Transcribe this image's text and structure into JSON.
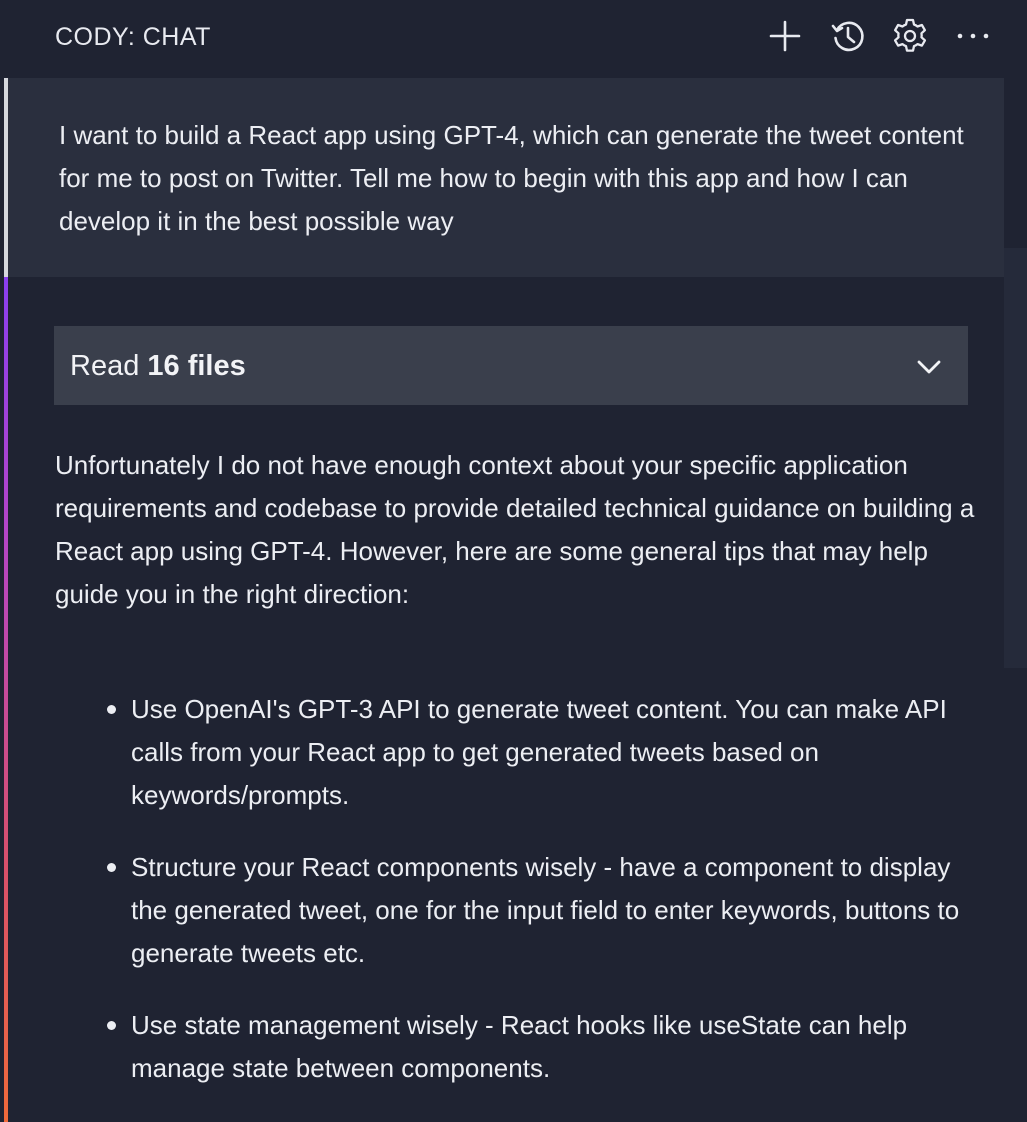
{
  "header": {
    "title": "CODY: CHAT",
    "icons": {
      "new": "plus-icon",
      "history": "history-icon",
      "settings": "gear-icon",
      "more": "ellipsis-icon"
    }
  },
  "human_message": {
    "text": "I want to build a React app using GPT-4, which can generate the tweet content for me to post on Twitter. Tell me how to begin with this app and how I can develop it in the best possible way"
  },
  "assistant_message": {
    "context": {
      "prefix": "Read ",
      "count_label": "16 files",
      "chevron": "chevron-down-icon"
    },
    "intro": "Unfortunately I do not have enough context about your specific application requirements and codebase to provide detailed technical guidance on building a React app using GPT-4. However, here are some general tips that may help guide you in the right direction:",
    "bullets": [
      "Use OpenAI's GPT-3 API to generate tweet content. You can make API calls from your React app to get generated tweets based on keywords/prompts.",
      "Structure your React components wisely - have a component to display the generated tweet, one for the input field to enter keywords, buttons to generate tweets etc.",
      "Use state management wisely - React hooks like useState can help manage state between components."
    ]
  },
  "colors": {
    "background": "#1f2332",
    "human_background": "#2a2f3e",
    "context_background": "#3a3f4c",
    "assistant_gradient_top": "#8a3ff0",
    "assistant_gradient_bottom": "#f06a3a"
  }
}
